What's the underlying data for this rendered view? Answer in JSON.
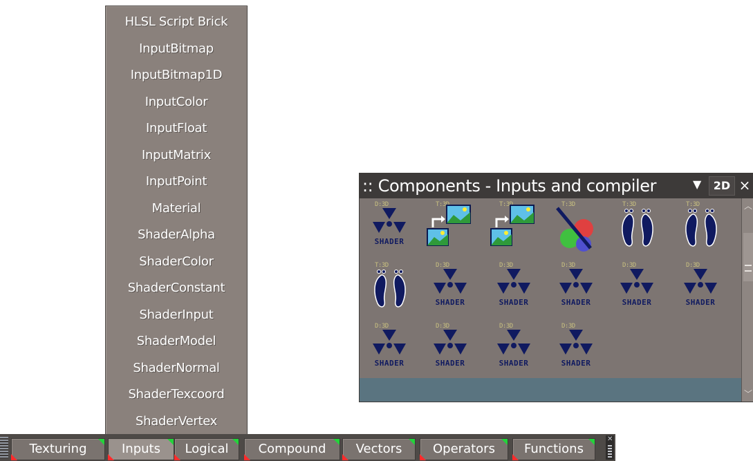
{
  "menu": {
    "items": [
      {
        "label": "HLSL Script Brick"
      },
      {
        "label": "InputBitmap"
      },
      {
        "label": "InputBitmap1D"
      },
      {
        "label": "InputColor"
      },
      {
        "label": "InputFloat"
      },
      {
        "label": "InputMatrix"
      },
      {
        "label": "InputPoint"
      },
      {
        "label": "Material"
      },
      {
        "label": "ShaderAlpha"
      },
      {
        "label": "ShaderColor"
      },
      {
        "label": "ShaderConstant"
      },
      {
        "label": "ShaderInput"
      },
      {
        "label": "ShaderModel"
      },
      {
        "label": "ShaderNormal"
      },
      {
        "label": "ShaderTexcoord"
      },
      {
        "label": "ShaderVertex"
      }
    ]
  },
  "tabs": [
    {
      "label": "Texturing",
      "active": false
    },
    {
      "label": "Inputs",
      "active": true
    },
    {
      "label": "Logical",
      "active": false
    },
    {
      "label": "Compound",
      "active": false
    },
    {
      "label": "Vectors",
      "active": false
    },
    {
      "label": "Operators",
      "active": false
    },
    {
      "label": "Functions",
      "active": false
    }
  ],
  "panel": {
    "title": ":: Components - Inputs and compiler",
    "view_mode": "2D",
    "close_glyph": "×",
    "components": [
      {
        "icon": "shader-radiation-icon",
        "label": "SHADER",
        "version": "D:3D"
      },
      {
        "icon": "bitmap-copy-icon",
        "label": "",
        "version": "T:3D"
      },
      {
        "icon": "bitmap-copy-icon",
        "label": "",
        "version": "T:3D"
      },
      {
        "icon": "color-palette-icon",
        "label": "",
        "version": "T:3D"
      },
      {
        "icon": "footprint-icon",
        "label": "",
        "version": "T:3D"
      },
      {
        "icon": "footprint-icon",
        "label": "",
        "version": "T:3D"
      },
      {
        "icon": "footprint-icon",
        "label": "",
        "version": "T:3D"
      },
      {
        "icon": "shader-radiation-icon",
        "label": "SHADER",
        "version": "D:3D"
      },
      {
        "icon": "shader-radiation-icon",
        "label": "SHADER",
        "version": "D:3D"
      },
      {
        "icon": "shader-radiation-icon",
        "label": "SHADER",
        "version": "D:3D"
      },
      {
        "icon": "shader-radiation-icon",
        "label": "SHADER",
        "version": "D:3D"
      },
      {
        "icon": "shader-radiation-icon",
        "label": "SHADER",
        "version": "D:3D"
      },
      {
        "icon": "shader-radiation-icon",
        "label": "SHADER",
        "version": "D:3D"
      },
      {
        "icon": "shader-radiation-icon",
        "label": "SHADER",
        "version": "D:3D"
      },
      {
        "icon": "shader-radiation-icon",
        "label": "SHADER",
        "version": "D:3D"
      },
      {
        "icon": "shader-radiation-icon",
        "label": "SHADER",
        "version": "D:3D"
      }
    ]
  },
  "colors": {
    "menu_bg": "#8a817c",
    "tab_bg": "#7a736f",
    "panel_bg": "#7d7572",
    "icon_navy": "#101a60",
    "tab_marker_green": "#22d43a",
    "tab_marker_red": "#ff2b2b"
  }
}
